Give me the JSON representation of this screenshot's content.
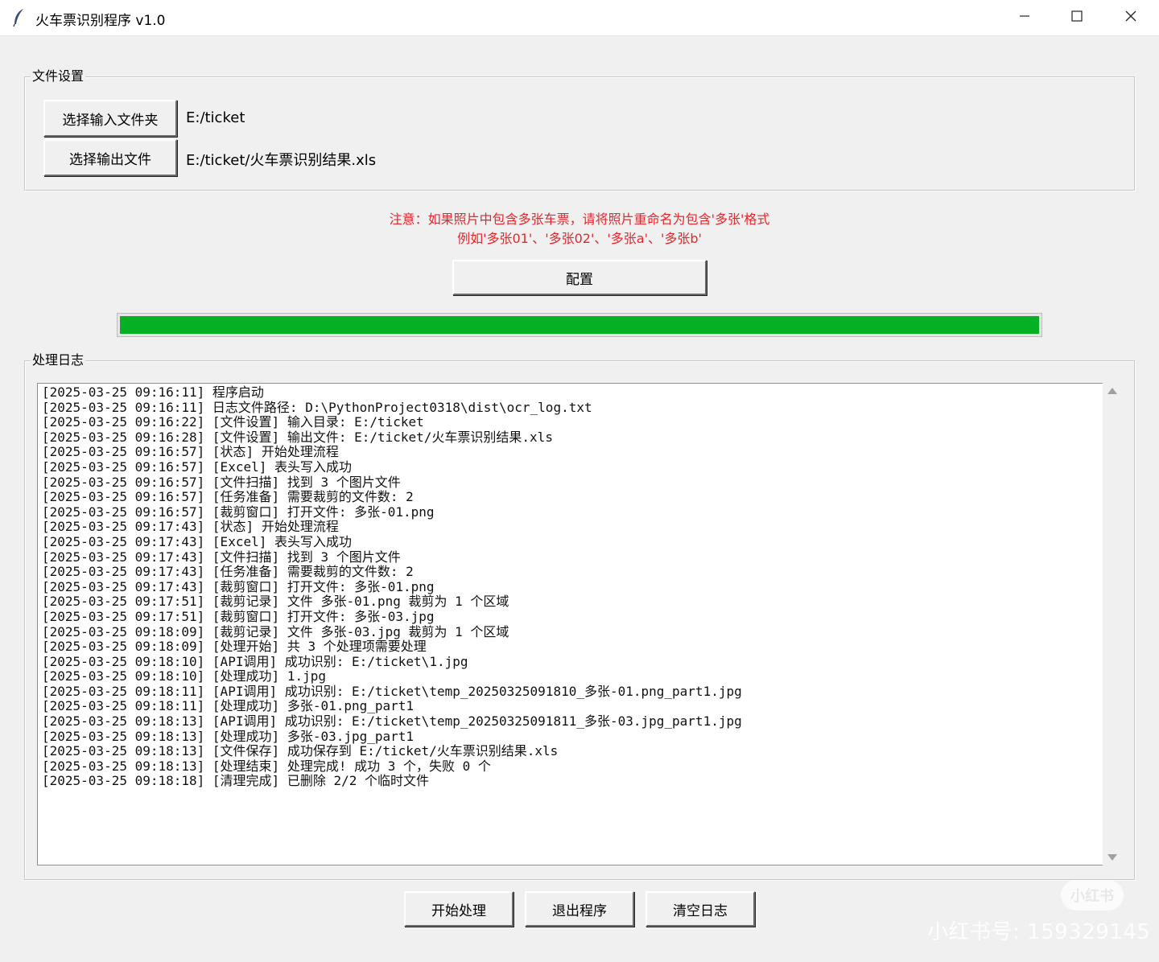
{
  "window": {
    "title": "火车票识别程序 v1.0",
    "minimize_glyph": "—",
    "maximize_glyph": "☐",
    "close_glyph": "✕"
  },
  "file_settings": {
    "legend": "文件设置",
    "input_button_label": "选择输入文件夹",
    "input_path": "E:/ticket",
    "output_button_label": "选择输出文件",
    "output_path": "E:/ticket/火车票识别结果.xls"
  },
  "notice": {
    "line1": "注意：如果照片中包含多张车票，请将照片重命名为包含'多张'格式",
    "line2": "例如'多张01'、'多张02'、'多张a'、'多张b'",
    "color": "#e8262a"
  },
  "config_button_label": "配置",
  "progress": {
    "value": 1.0,
    "color": "#06b025"
  },
  "log": {
    "legend": "处理日志",
    "lines": [
      "[2025-03-25 09:16:11] 程序启动",
      "[2025-03-25 09:16:11] 日志文件路径: D:\\PythonProject0318\\dist\\ocr_log.txt",
      "[2025-03-25 09:16:22] [文件设置] 输入目录: E:/ticket",
      "[2025-03-25 09:16:28] [文件设置] 输出文件: E:/ticket/火车票识别结果.xls",
      "[2025-03-25 09:16:57] [状态] 开始处理流程",
      "[2025-03-25 09:16:57] [Excel] 表头写入成功",
      "[2025-03-25 09:16:57] [文件扫描] 找到 3 个图片文件",
      "[2025-03-25 09:16:57] [任务准备] 需要裁剪的文件数: 2",
      "[2025-03-25 09:16:57] [裁剪窗口] 打开文件: 多张-01.png",
      "[2025-03-25 09:17:43] [状态] 开始处理流程",
      "[2025-03-25 09:17:43] [Excel] 表头写入成功",
      "[2025-03-25 09:17:43] [文件扫描] 找到 3 个图片文件",
      "[2025-03-25 09:17:43] [任务准备] 需要裁剪的文件数: 2",
      "[2025-03-25 09:17:43] [裁剪窗口] 打开文件: 多张-01.png",
      "[2025-03-25 09:17:51] [裁剪记录] 文件 多张-01.png 裁剪为 1 个区域",
      "[2025-03-25 09:17:51] [裁剪窗口] 打开文件: 多张-03.jpg",
      "[2025-03-25 09:18:09] [裁剪记录] 文件 多张-03.jpg 裁剪为 1 个区域",
      "[2025-03-25 09:18:09] [处理开始] 共 3 个处理项需要处理",
      "[2025-03-25 09:18:10] [API调用] 成功识别: E:/ticket\\1.jpg",
      "[2025-03-25 09:18:10] [处理成功] 1.jpg",
      "[2025-03-25 09:18:11] [API调用] 成功识别: E:/ticket\\temp_20250325091810_多张-01.png_part1.jpg",
      "[2025-03-25 09:18:11] [处理成功] 多张-01.png_part1",
      "[2025-03-25 09:18:13] [API调用] 成功识别: E:/ticket\\temp_20250325091811_多张-03.jpg_part1.jpg",
      "[2025-03-25 09:18:13] [处理成功] 多张-03.jpg_part1",
      "[2025-03-25 09:18:13] [文件保存] 成功保存到 E:/ticket/火车票识别结果.xls",
      "[2025-03-25 09:18:13] [处理结束] 处理完成! 成功 3 个，失败 0 个",
      "[2025-03-25 09:18:18] [清理完成] 已删除 2/2 个临时文件"
    ]
  },
  "bottom_buttons": {
    "start": "开始处理",
    "exit": "退出程序",
    "clear": "清空日志"
  },
  "watermark": {
    "logo": "小红书",
    "text": "小红书号: 159329145"
  }
}
